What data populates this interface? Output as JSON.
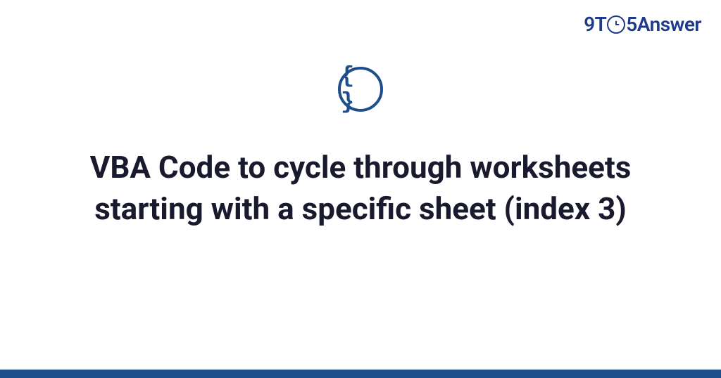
{
  "header": {
    "logo_prefix": "9T",
    "logo_clock_glyph": "①",
    "logo_suffix": "5Answer"
  },
  "content": {
    "category_icon_glyph": "{ }",
    "title": "VBA Code to cycle through worksheets starting with a specific sheet (index 3)"
  },
  "colors": {
    "brand_primary": "#1e4e8c",
    "text_dark": "#1a1a2e"
  }
}
